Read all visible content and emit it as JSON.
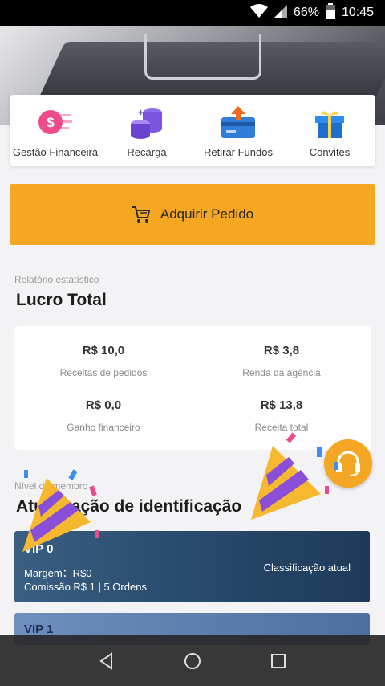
{
  "status_bar": {
    "battery": "66%",
    "time": "10:45"
  },
  "quick_actions": [
    {
      "label": "Gestão Financeira",
      "icon": "money-icon"
    },
    {
      "label": "Recarga",
      "icon": "coins-icon"
    },
    {
      "label": "Retirar Fundos",
      "icon": "withdraw-card-icon"
    },
    {
      "label": "Convites",
      "icon": "gift-icon"
    }
  ],
  "order_button": {
    "label": "Adquirir Pedido",
    "icon": "cart-icon"
  },
  "stats_section": {
    "subtitle": "Relatório estatístico",
    "title": "Lucro Total",
    "items": [
      {
        "value": "R$ 10,0",
        "label": "Receitas de pedidos"
      },
      {
        "value": "R$ 3,8",
        "label": "Renda da agência"
      },
      {
        "value": "R$ 0,0",
        "label": "Ganho financeiro"
      },
      {
        "value": "R$ 13,8",
        "label": "Receita total"
      }
    ]
  },
  "level_section": {
    "subtitle": "Nível de membro",
    "title": "Atualização de identificação",
    "current_card": {
      "name": "VIP 0",
      "margin": "Margem：R$0",
      "commission": "Comissão R$ 1 | 5 Ordens",
      "current_label": "Classificação atual"
    },
    "next_card": {
      "name": "VIP 1"
    }
  },
  "colors": {
    "accent": "#f5a623",
    "vip_dark": "#284a6c"
  }
}
